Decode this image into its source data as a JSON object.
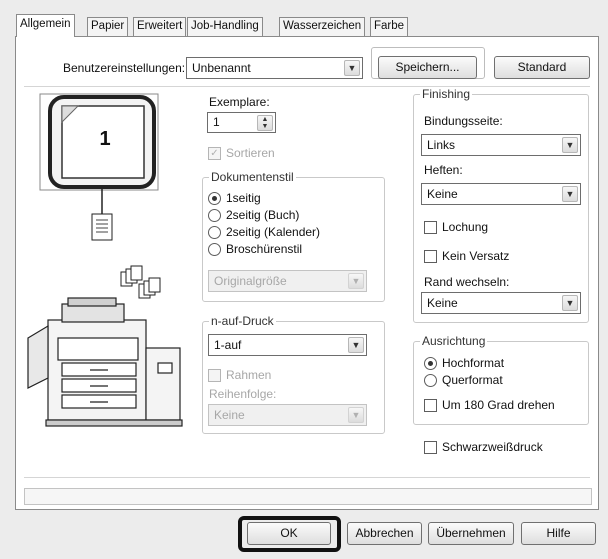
{
  "tabs": [
    "Allgemein",
    "Papier",
    "Erweitert",
    "Job-Handling",
    "Wasserzeichen",
    "Farbe"
  ],
  "user_settings": {
    "label": "Benutzereinstellungen:",
    "value": "Unbenannt",
    "save_label": "Speichern...",
    "default_label": "Standard"
  },
  "preview": {
    "page_number": "1"
  },
  "copies": {
    "label": "Exemplare:",
    "value": "1",
    "collate_label": "Sortieren"
  },
  "document_style": {
    "title": "Dokumentenstil",
    "options": [
      "1seitig",
      "2seitig (Buch)",
      "2seitig (Kalender)",
      "Broschürenstil"
    ],
    "selected": "1seitig",
    "size_value": "Originalgröße"
  },
  "n_up": {
    "title": "n-auf-Druck",
    "value": "1-auf",
    "border_label": "Rahmen",
    "order_label": "Reihenfolge:",
    "order_value": "Keine"
  },
  "finishing": {
    "title": "Finishing",
    "binding_label": "Bindungsseite:",
    "binding_value": "Links",
    "staple_label": "Heften:",
    "staple_value": "Keine",
    "punch_label": "Lochung",
    "offset_label": "Kein Versatz",
    "margin_shift_label": "Rand wechseln:",
    "margin_shift_value": "Keine"
  },
  "orientation": {
    "title": "Ausrichtung",
    "portrait_label": "Hochformat",
    "landscape_label": "Querformat",
    "selected": "Hochformat",
    "rotate_label": "Um 180 Grad drehen"
  },
  "bw_label": "Schwarzweißdruck",
  "footer": {
    "ok_label": "OK",
    "cancel_label": "Abbrechen",
    "apply_label": "Übernehmen",
    "help_label": "Hilfe"
  }
}
